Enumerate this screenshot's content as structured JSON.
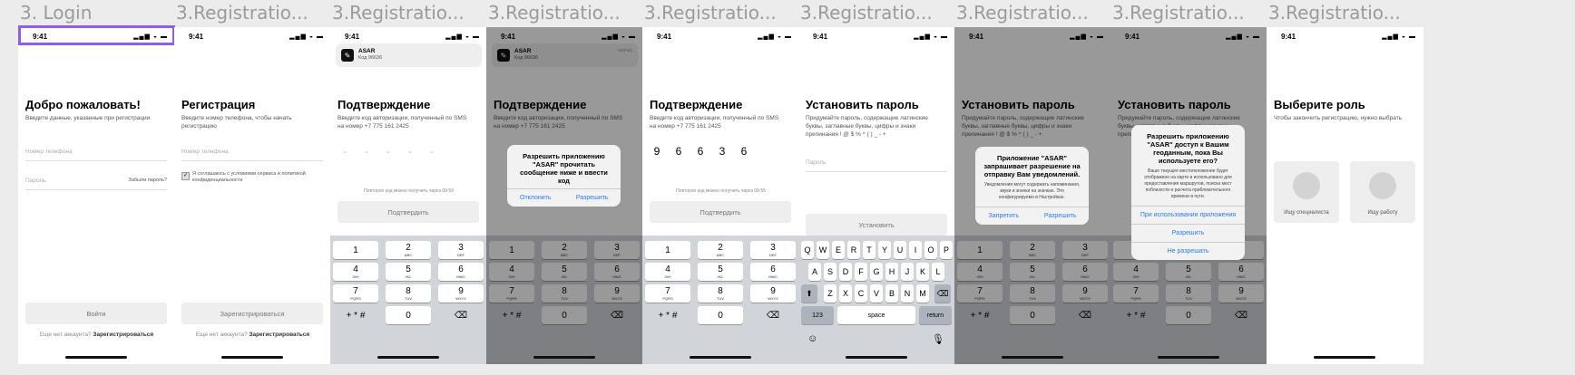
{
  "time": "9:41",
  "status_icons": "▂▄▆ ◒ ▬",
  "labels": [
    "3. Login",
    "3.Registratio...",
    "3.Registratio...",
    "3.Registratio...",
    "3.Registratio...",
    "3.Registratio...",
    "3.Registratio...",
    "3.Registratio...",
    "3.Registratio..."
  ],
  "s1": {
    "title": "Добро пожаловать!",
    "sub": "Введите данные, указанные при регистрации",
    "phone": "Номер телефона",
    "password": "Пароль",
    "forgot": "Забыли пароль?",
    "login": "Войти",
    "no_account": "Еще нет аккаунта?",
    "register": "Зарегистрироваться"
  },
  "s2": {
    "title": "Регистрация",
    "sub": "Введите номер телефона, чтобы начать регистрацию",
    "phone": "Номер телефона",
    "agree": "Я соглашаюсь с условиями сервиса и политикой конфиденциальности",
    "register_btn": "Зарегистрироваться",
    "have_account": "Еще нет аккаунта?",
    "register": "Зарегистрироваться"
  },
  "notif": {
    "app": "ASAR",
    "code": "Код 96636",
    "when": "сейчас"
  },
  "confirm": {
    "title": "Подтверждение",
    "sub": "Введите код авторизации, полученный по SMS на номер +7 775 161 2425",
    "resend": "Повторно код можно получить через 00:59",
    "resend2": "Повторно код можно получить через 00:55",
    "btn": "Подтвердить",
    "code": [
      "9",
      "6",
      "6",
      "3",
      "6"
    ]
  },
  "keypad": {
    "keys": [
      [
        "1",
        ""
      ],
      [
        "2",
        "ABC"
      ],
      [
        "3",
        "DEF"
      ],
      [
        "4",
        "GHI"
      ],
      [
        "5",
        "JKL"
      ],
      [
        "6",
        "MNO"
      ],
      [
        "7",
        "PQRS"
      ],
      [
        "8",
        "TUV"
      ],
      [
        "9",
        "WXYZ"
      ]
    ],
    "special": "+ * #",
    "zero": "0",
    "del": "⌫"
  },
  "alert_sms": {
    "title": "Разрешить приложению \"ASAR\" прочитать сообщение ниже и ввести код",
    "deny": "Отклонить",
    "allow": "Разрешить"
  },
  "pass": {
    "title": "Установить пароль",
    "sub": "Придумайте пароль, содержащие латинские буквы, заглавные буквы, цифры и знаки препинания ! @ $ % ^ ( ) _ - +",
    "field": "Пароль",
    "btn": "Установить"
  },
  "qwerty": {
    "r1": [
      "Q",
      "W",
      "E",
      "R",
      "T",
      "Y",
      "U",
      "I",
      "O",
      "P"
    ],
    "r2": [
      "A",
      "S",
      "D",
      "F",
      "G",
      "H",
      "J",
      "K",
      "L"
    ],
    "r3": [
      "Z",
      "X",
      "C",
      "V",
      "B",
      "N",
      "M"
    ],
    "num": "123",
    "space": "space",
    "ret": "return"
  },
  "alert_notif": {
    "title": "Приложение \"ASAR\" запрашивает разрешение на отправку Вам уведомлений.",
    "msg": "Уведомления могут содержать напоминания, звуки и значки на значках. Это конфигурируемо в Настройках.",
    "deny": "Запретить",
    "allow": "Разрешить"
  },
  "alert_geo": {
    "title": "Разрешить приложению \"ASAR\" доступ к Вашим геоданным, пока Вы используете его?",
    "msg": "Ваше текущее местоположение будет отображено на карте и использовано для предоставления маршрутов, поиска мест поблизости и расчета приблизительного времени в пути.",
    "opt1": "При использовании приложения",
    "opt2": "Разрешить",
    "opt3": "Не разрешать"
  },
  "role": {
    "title": "Выберите роль",
    "sub": "Чтобы закончить регистрацию, нужно выбрать",
    "r1": "Ищу специалиста",
    "r2": "Ищу работу"
  }
}
